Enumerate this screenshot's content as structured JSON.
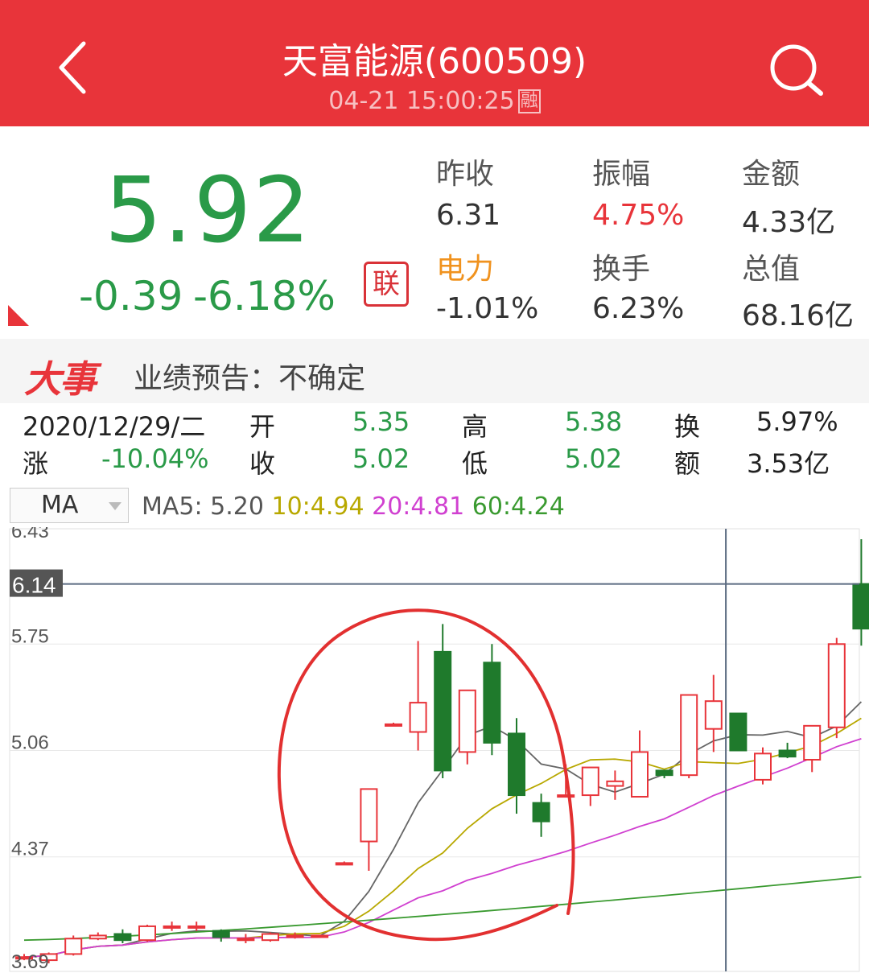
{
  "header": {
    "title": "天富能源(600509)",
    "datetime": "04-21 15:00:25",
    "badge": "融"
  },
  "quote": {
    "price": "5.92",
    "change": "-0.39",
    "change_pct": "-6.18%",
    "link_badge": "联",
    "stats": [
      {
        "label": "昨收",
        "value": "6.31"
      },
      {
        "label": "振幅",
        "value": "4.75%"
      },
      {
        "label": "金额",
        "value": "4.33亿"
      },
      {
        "label": "电力",
        "value": "-1.01%"
      },
      {
        "label": "换手",
        "value": "6.23%"
      },
      {
        "label": "总值",
        "value": "68.16亿"
      }
    ]
  },
  "event": {
    "tag": "大事",
    "text": "业绩预告：不确定"
  },
  "day_info": {
    "date": "2020/12/29/二",
    "open_label": "开",
    "open": "5.35",
    "high_label": "高",
    "high": "5.38",
    "turnover_label": "换",
    "turnover": "5.97%",
    "change_label": "涨",
    "change": "-10.04%",
    "close_label": "收",
    "close": "5.02",
    "low_label": "低",
    "low": "5.02",
    "amount_label": "额",
    "amount": "3.53亿"
  },
  "ma": {
    "selected": "MA",
    "ma5_label": "MA5:",
    "ma5": "5.20",
    "ma10_label": "10:",
    "ma10": "4.94",
    "ma20_label": "20:",
    "ma20": "4.81",
    "ma60_label": "60:",
    "ma60": "4.24"
  },
  "colors": {
    "header_red": "#e8343a",
    "up_red": "#e8343a",
    "down_green": "#1f7a2c",
    "ma5": "#666666",
    "ma10": "#b8a800",
    "ma20": "#d040d0",
    "ma60": "#3a9a30"
  },
  "chart_data": {
    "type": "candlestick",
    "y_ticks": [
      "6.43",
      "5.75",
      "5.06",
      "4.37",
      "3.69"
    ],
    "crosshair_price": "6.14",
    "ylim": [
      3.69,
      6.43
    ],
    "candles": [
      {
        "o": 3.72,
        "h": 3.74,
        "l": 3.7,
        "c": 3.72
      },
      {
        "o": 3.7,
        "h": 3.75,
        "l": 3.68,
        "c": 3.74
      },
      {
        "o": 3.74,
        "h": 3.86,
        "l": 3.73,
        "c": 3.84
      },
      {
        "o": 3.84,
        "h": 3.88,
        "l": 3.83,
        "c": 3.86
      },
      {
        "o": 3.87,
        "h": 3.9,
        "l": 3.81,
        "c": 3.83
      },
      {
        "o": 3.83,
        "h": 3.93,
        "l": 3.82,
        "c": 3.92
      },
      {
        "o": 3.92,
        "h": 3.95,
        "l": 3.89,
        "c": 3.92
      },
      {
        "o": 3.92,
        "h": 3.95,
        "l": 3.89,
        "c": 3.92
      },
      {
        "o": 3.89,
        "h": 3.9,
        "l": 3.82,
        "c": 3.85
      },
      {
        "o": 3.84,
        "h": 3.87,
        "l": 3.81,
        "c": 3.84
      },
      {
        "o": 3.83,
        "h": 3.88,
        "l": 3.82,
        "c": 3.87
      },
      {
        "o": 3.86,
        "h": 3.88,
        "l": 3.84,
        "c": 3.86
      },
      {
        "o": 3.86,
        "h": 3.86,
        "l": 3.86,
        "c": 3.86
      },
      {
        "o": 4.33,
        "h": 4.34,
        "l": 4.32,
        "c": 4.33
      },
      {
        "o": 4.47,
        "h": 4.8,
        "l": 4.28,
        "c": 4.81
      },
      {
        "o": 5.23,
        "h": 5.24,
        "l": 5.22,
        "c": 5.23
      },
      {
        "o": 5.18,
        "h": 5.77,
        "l": 5.06,
        "c": 5.37
      },
      {
        "o": 5.7,
        "h": 5.88,
        "l": 4.88,
        "c": 4.93
      },
      {
        "o": 5.05,
        "h": 5.45,
        "l": 4.97,
        "c": 5.45
      },
      {
        "o": 5.63,
        "h": 5.75,
        "l": 5.03,
        "c": 5.11
      },
      {
        "o": 5.17,
        "h": 5.27,
        "l": 4.65,
        "c": 4.77
      },
      {
        "o": 4.72,
        "h": 4.78,
        "l": 4.5,
        "c": 4.6
      },
      {
        "o": 4.77,
        "h": 4.97,
        "l": 4.77,
        "c": 4.77
      },
      {
        "o": 4.77,
        "h": 4.95,
        "l": 4.7,
        "c": 4.95
      },
      {
        "o": 4.83,
        "h": 4.93,
        "l": 4.74,
        "c": 4.86
      },
      {
        "o": 4.76,
        "h": 5.19,
        "l": 4.76,
        "c": 5.05
      },
      {
        "o": 4.93,
        "h": 4.93,
        "l": 4.88,
        "c": 4.9
      },
      {
        "o": 4.9,
        "h": 5.37,
        "l": 4.88,
        "c": 5.42
      },
      {
        "o": 5.2,
        "h": 5.55,
        "l": 5.05,
        "c": 5.38
      },
      {
        "o": 5.3,
        "h": 5.3,
        "l": 5.06,
        "c": 5.06
      },
      {
        "o": 4.87,
        "h": 5.08,
        "l": 4.84,
        "c": 5.04
      },
      {
        "o": 5.06,
        "h": 5.11,
        "l": 5.01,
        "c": 5.02
      },
      {
        "o": 5.0,
        "h": 5.22,
        "l": 4.92,
        "c": 5.22
      },
      {
        "o": 5.21,
        "h": 5.79,
        "l": 5.14,
        "c": 5.75
      },
      {
        "o": 6.14,
        "h": 6.43,
        "l": 5.74,
        "c": 5.85
      }
    ]
  }
}
